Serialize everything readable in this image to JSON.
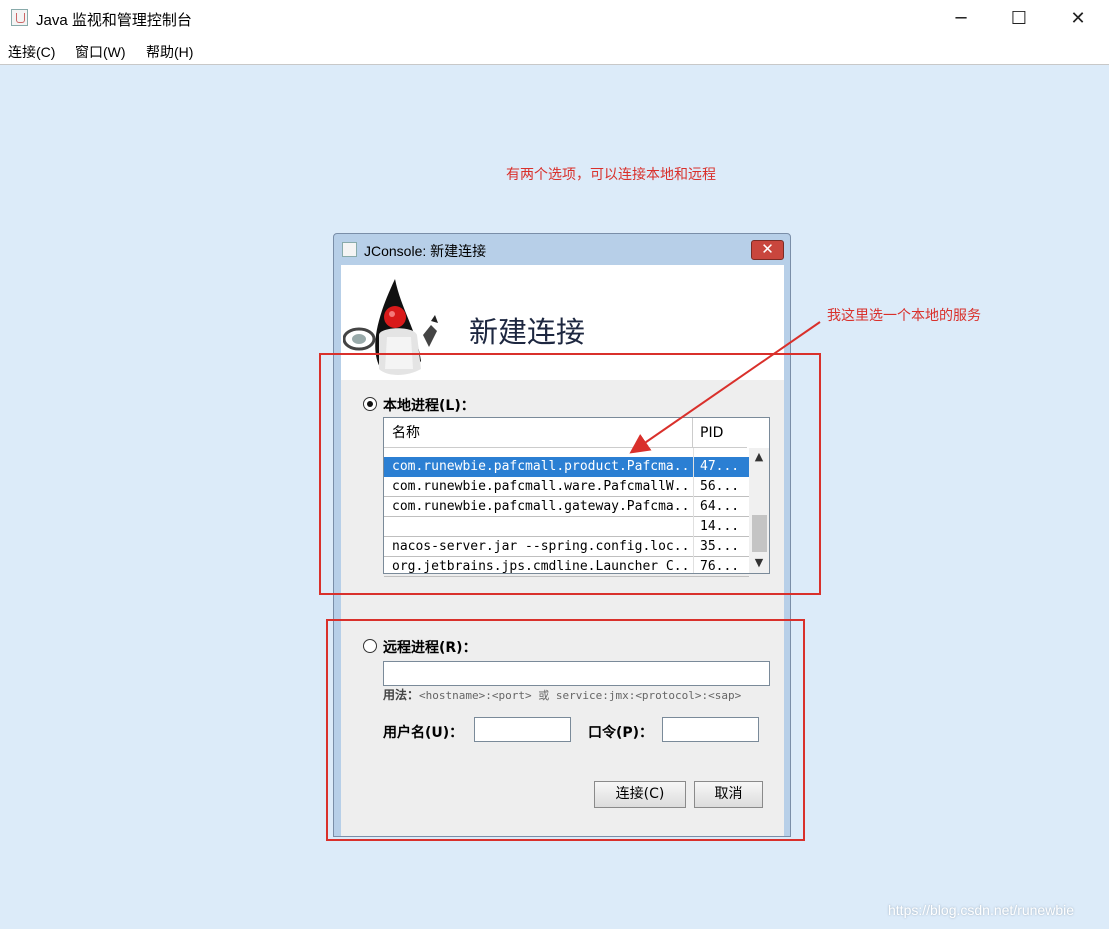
{
  "window": {
    "title": "Java 监视和管理控制台",
    "minimize_glyph": "─",
    "maximize_glyph": "☐",
    "close_glyph": "✕"
  },
  "menubar": {
    "items": [
      "连接(C)",
      "窗口(W)",
      "帮助(H)"
    ]
  },
  "annotations": {
    "top": "有两个选项，可以连接本地和远程",
    "arrow": "我这里选一个本地的服务"
  },
  "dialog": {
    "title": "JConsole: 新建连接",
    "close_glyph": "✕",
    "banner_title": "新建连接",
    "local": {
      "label": "本地进程(L)：",
      "checked": true,
      "columns": [
        "名称",
        "PID"
      ],
      "rows": [
        {
          "name": "com.runewbie.pafcmall.product.Pafcma..",
          "pid": "47...",
          "selected": true
        },
        {
          "name": "com.runewbie.pafcmall.ware.PafcmallW..",
          "pid": "56...",
          "selected": false
        },
        {
          "name": "com.runewbie.pafcmall.gateway.Pafcma..",
          "pid": "64...",
          "selected": false
        },
        {
          "name": "",
          "pid": "14...",
          "selected": false
        },
        {
          "name": "nacos-server.jar --spring.config.loc..",
          "pid": "35...",
          "selected": false
        },
        {
          "name": "org.jetbrains.jps.cmdline.Launcher C..",
          "pid": "76...",
          "selected": false
        }
      ]
    },
    "remote": {
      "label": "远程进程(R)：",
      "checked": false,
      "value": "",
      "usage_label": "用法：",
      "usage_text": "<hostname>:<port> 或 service:jmx:<protocol>:<sap>",
      "username_label": "用户名(U)：",
      "username_value": "",
      "password_label": "口令(P)：",
      "password_value": ""
    },
    "buttons": {
      "connect": "连接(C)",
      "cancel": "取消"
    }
  },
  "watermark": "https://blog.csdn.net/runewbie",
  "icons": [
    "java-app-icon",
    "duke-mascot-icon",
    "radio-icon",
    "scroll-up-icon",
    "scroll-down-icon"
  ],
  "colors": {
    "annotation": "#d9302b",
    "selection": "#2b7fd3",
    "dialog_close": "#c9463d"
  }
}
